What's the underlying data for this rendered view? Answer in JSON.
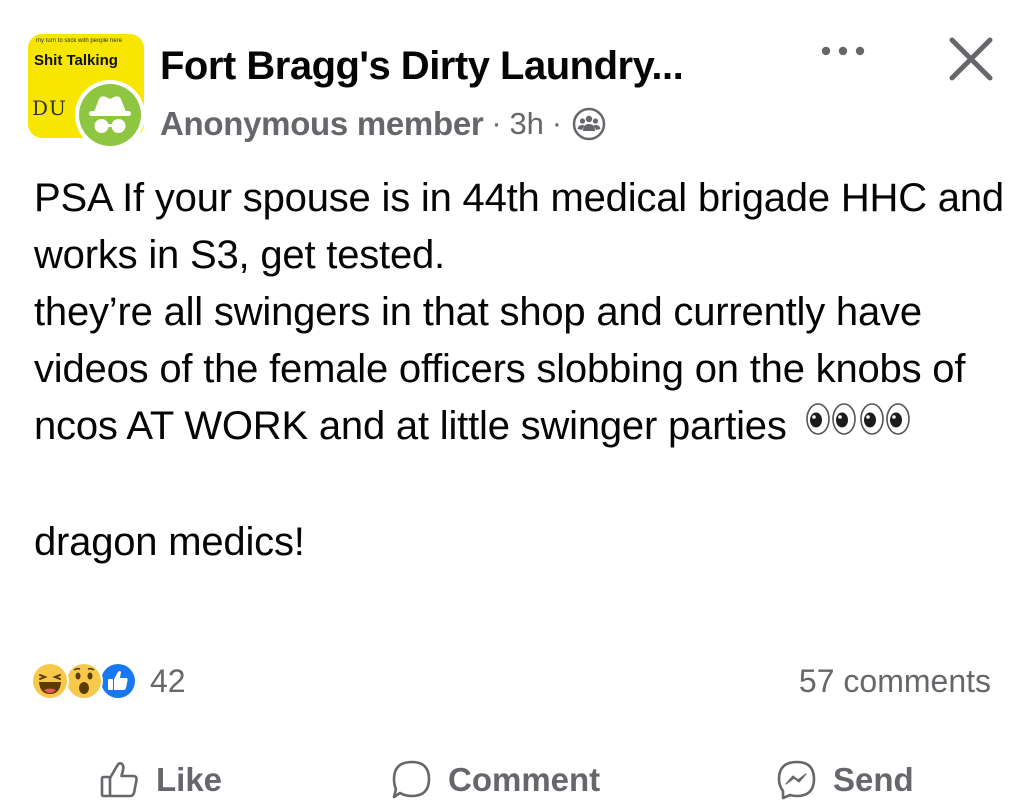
{
  "header": {
    "logo": {
      "top_line": "my turn to stick with people here",
      "title": "Shit Talking",
      "letters": "DU"
    },
    "group_name": "Fort Bragg's Dirty Laundry...",
    "author": "Anonymous member",
    "separator": "·",
    "time": "3h",
    "privacy_icon": "group-members-icon",
    "more_icon": "more-options-icon",
    "close_icon": "close-icon"
  },
  "post": {
    "text": "PSA If your spouse is in 44th medical brigade HHC and works in S3, get tested.\nthey’re all swingers in that shop and currently have videos of the female officers slobbing on the knobs of ncos AT WORK and at little swinger parties",
    "emoji": "👀👀",
    "text_after": "\n\ndragon medics!"
  },
  "stats": {
    "reactions": [
      "haha",
      "wow",
      "like"
    ],
    "reaction_count": "42",
    "comments": "57 comments"
  },
  "actions": {
    "like": "Like",
    "comment": "Comment",
    "send": "Send"
  },
  "colors": {
    "text": "#050505",
    "secondary": "#65676b",
    "like_blue": "#1877f2",
    "logo_yellow": "#f6e600",
    "anon_green": "#8fc641"
  }
}
